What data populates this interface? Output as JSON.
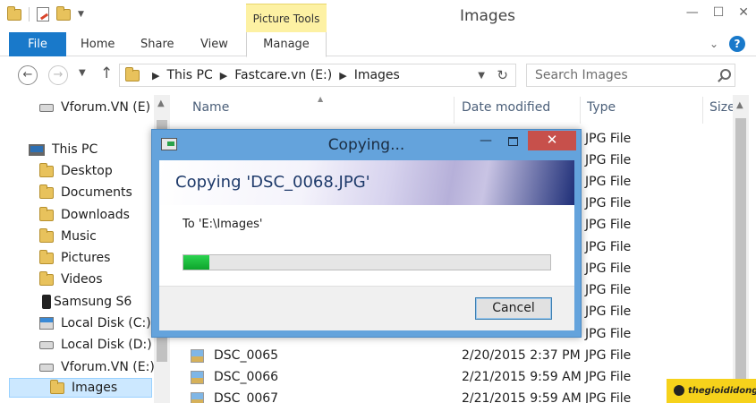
{
  "window": {
    "title": "Images",
    "contextual_tab_group": "Picture Tools",
    "controls": {
      "minimize": "—",
      "maximize": "☐",
      "close": "✕"
    }
  },
  "ribbon": {
    "file_tab": "File",
    "tabs": [
      "Home",
      "Share",
      "View"
    ],
    "contextual_tab": "Manage",
    "collapse_glyph": "⌄",
    "help_glyph": "?"
  },
  "address_bar": {
    "path": [
      "This PC",
      "Fastcare.vn (E:)",
      "Images"
    ],
    "search_placeholder": "Search Images"
  },
  "nav_pane": {
    "items": [
      {
        "label": "Vforum.VN (E)",
        "icon": "drive-icon"
      },
      {
        "label": "This PC",
        "icon": "pc-icon"
      },
      {
        "label": "Desktop",
        "icon": "folder-icon"
      },
      {
        "label": "Documents",
        "icon": "folder-icon"
      },
      {
        "label": "Downloads",
        "icon": "folder-icon"
      },
      {
        "label": "Music",
        "icon": "folder-icon"
      },
      {
        "label": "Pictures",
        "icon": "folder-icon"
      },
      {
        "label": "Videos",
        "icon": "folder-icon"
      },
      {
        "label": "Samsung S6",
        "icon": "phone-icon"
      },
      {
        "label": "Local Disk (C:)",
        "icon": "system-drive-icon"
      },
      {
        "label": "Local Disk (D:)",
        "icon": "drive-icon"
      },
      {
        "label": "Vforum.VN (E:)",
        "icon": "drive-icon"
      },
      {
        "label": "Images",
        "icon": "folder-icon",
        "selected": true
      }
    ]
  },
  "file_list": {
    "columns": [
      "Name",
      "Date modified",
      "Type",
      "Size"
    ],
    "partial_rows": [
      "JPG File",
      "JPG File",
      "JPG File",
      "JPG File",
      "JPG File",
      "JPG File",
      "JPG File",
      "JPG File",
      "JPG File",
      "JPG File"
    ],
    "rows": [
      {
        "name": "DSC_0065",
        "date": "2/20/2015 2:37 PM",
        "type": "JPG File"
      },
      {
        "name": "DSC_0066",
        "date": "2/21/2015 9:59 AM",
        "type": "JPG File"
      },
      {
        "name": "DSC_0067",
        "date": "2/21/2015 9:59 AM",
        "type": "JPG File"
      }
    ]
  },
  "copy_dialog": {
    "caption": "Copying...",
    "heading": "Copying 'DSC_0068.JPG'",
    "destination": "To 'E:\\Images'",
    "progress": 0.07,
    "cancel_label": "Cancel",
    "progress_color": "#1fbf3f"
  },
  "watermark": {
    "text": "thegioididong"
  }
}
